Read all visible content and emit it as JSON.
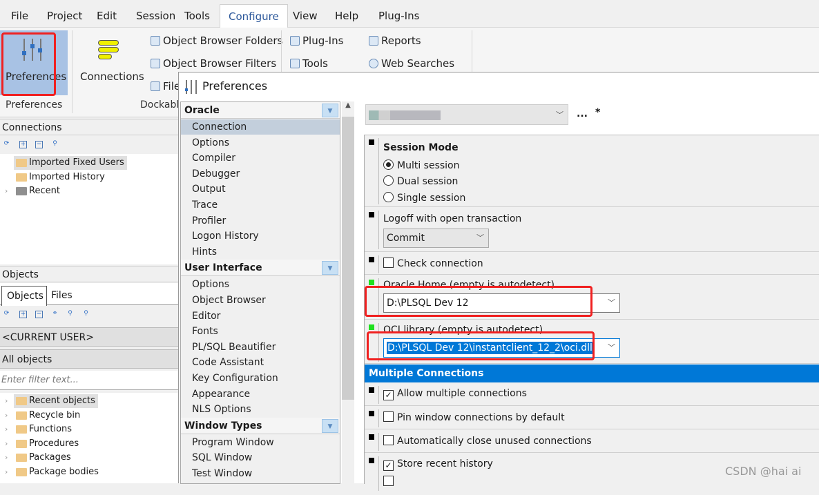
{
  "menu": [
    "File",
    "Project",
    "Edit",
    "Session",
    "Tools",
    "Configure",
    "View",
    "Help",
    "Plug-Ins"
  ],
  "menu_active": "Configure",
  "ribbon": {
    "preferences": "Preferences",
    "connections": "Connections",
    "ob_folders": "Object Browser Folders",
    "ob_filters": "Object Browser Filters",
    "file_partial": "File",
    "plugins": "Plug-Ins",
    "tools": "Tools",
    "reports": "Reports",
    "web_searches": "Web Searches",
    "group_preferences": "Preferences",
    "group_dockable": "Dockabl"
  },
  "connections_pane": {
    "title": "Connections",
    "items": [
      {
        "label": "Imported Fixed Users",
        "icon": "folder-icon"
      },
      {
        "label": "Imported History",
        "icon": "folder-icon"
      },
      {
        "label": "Recent",
        "icon": "folder-grey-icon"
      }
    ]
  },
  "objects_pane": {
    "title": "Objects",
    "tabs": [
      "Objects",
      "Files"
    ],
    "user": "<CURRENT USER>",
    "filter": "All objects",
    "filter_placeholder": "Enter filter text...",
    "items": [
      "Recent objects",
      "Recycle bin",
      "Functions",
      "Procedures",
      "Packages",
      "Package bodies"
    ]
  },
  "dialog": {
    "title": "Preferences",
    "dots": "...",
    "star": "*",
    "categories": [
      {
        "name": "Oracle",
        "items": [
          "Connection",
          "Options",
          "Compiler",
          "Debugger",
          "Output",
          "Trace",
          "Profiler",
          "Logon History",
          "Hints"
        ]
      },
      {
        "name": "User Interface",
        "items": [
          "Options",
          "Object Browser",
          "Editor",
          "Fonts",
          "PL/SQL Beautifier",
          "Code Assistant",
          "Key Configuration",
          "Appearance",
          "NLS Options"
        ]
      },
      {
        "name": "Window Types",
        "items": [
          "Program Window",
          "SQL Window",
          "Test Window"
        ]
      }
    ],
    "selected": "Connection",
    "settings": {
      "session_mode": "Session Mode",
      "multi": "Multi session",
      "dual": "Dual session",
      "single": "Single session",
      "session_value": "Multi session",
      "logoff": "Logoff with open transaction",
      "logoff_value": "Commit",
      "check_connection": "Check connection",
      "check_connection_checked": false,
      "oracle_home_label": "Oracle Home (empty is autodetect)",
      "oracle_home_value": "D:\\PLSQL Dev 12",
      "oci_label": "OCI library (empty is autodetect)",
      "oci_value": "D:\\PLSQL Dev 12\\instantclient_12_2\\oci.dll",
      "multiple_connections": "Multiple Connections",
      "allow_multiple": "Allow multiple connections",
      "allow_multiple_checked": true,
      "pin_window": "Pin window connections by default",
      "pin_window_checked": false,
      "auto_close": "Automatically close unused connections",
      "auto_close_checked": false,
      "store_recent": "Store recent history",
      "store_recent_checked": true
    }
  },
  "watermark": "CSDN @hai ai",
  "colors": {
    "accent": "#0078d7",
    "highlight": "#f02020",
    "selection": "#c3cfdc",
    "ribbon_selected": "#a8c2e4"
  }
}
